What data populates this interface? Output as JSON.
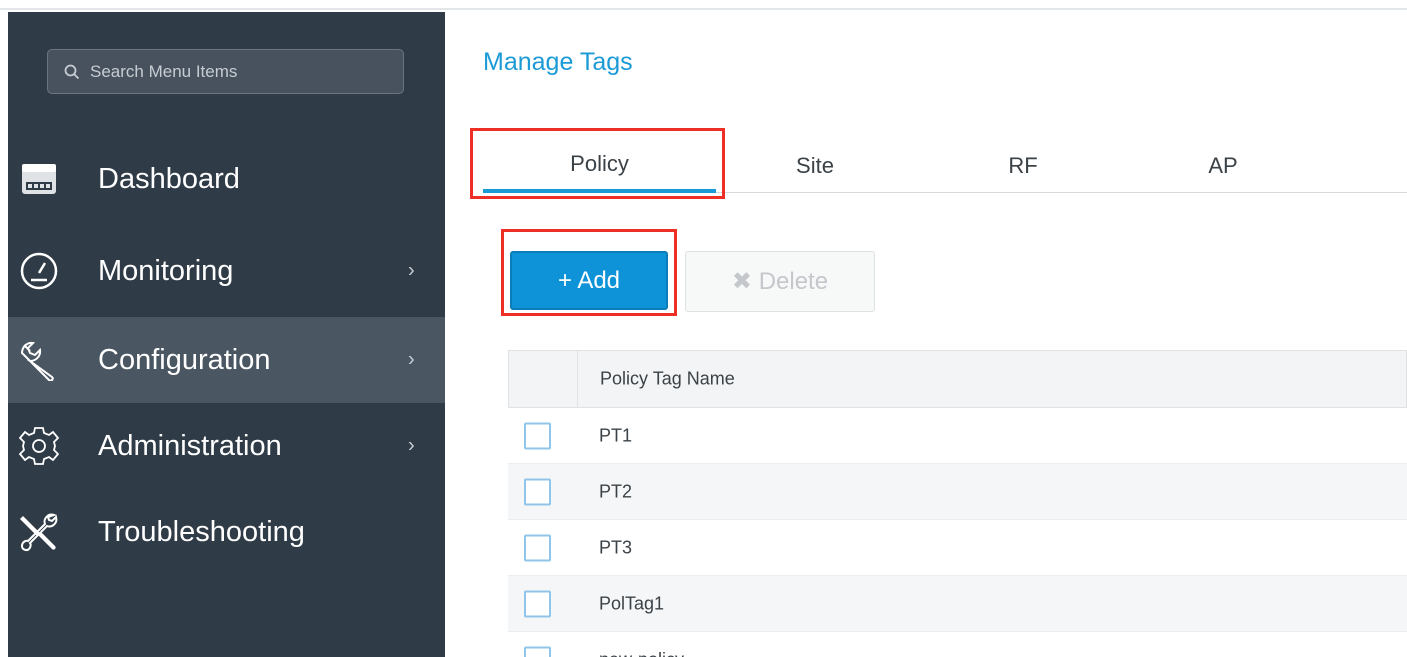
{
  "sidebar": {
    "search_placeholder": "Search Menu Items",
    "items": [
      {
        "label": "Dashboard",
        "icon": "dashboard-icon"
      },
      {
        "label": "Monitoring",
        "icon": "gauge-icon",
        "chevron": "›"
      },
      {
        "label": "Configuration",
        "icon": "wrench-icon",
        "chevron": "›",
        "active": true
      },
      {
        "label": "Administration",
        "icon": "gear-icon",
        "chevron": "›"
      },
      {
        "label": "Troubleshooting",
        "icon": "tools-icon"
      }
    ]
  },
  "main": {
    "title": "Manage Tags",
    "tabs": [
      {
        "label": "Policy",
        "active": true
      },
      {
        "label": "Site"
      },
      {
        "label": "RF"
      },
      {
        "label": "AP"
      }
    ],
    "toolbar": {
      "add_label": "+ Add",
      "delete_label": "✖ Delete"
    },
    "table": {
      "header": "Policy Tag Name",
      "rows": [
        "PT1",
        "PT2",
        "PT3",
        "PolTag1",
        "new-policy"
      ]
    }
  },
  "colors": {
    "accent": "#1b9ad6",
    "sidebar_bg": "#2f3b47",
    "highlight": "#ee2f26"
  }
}
